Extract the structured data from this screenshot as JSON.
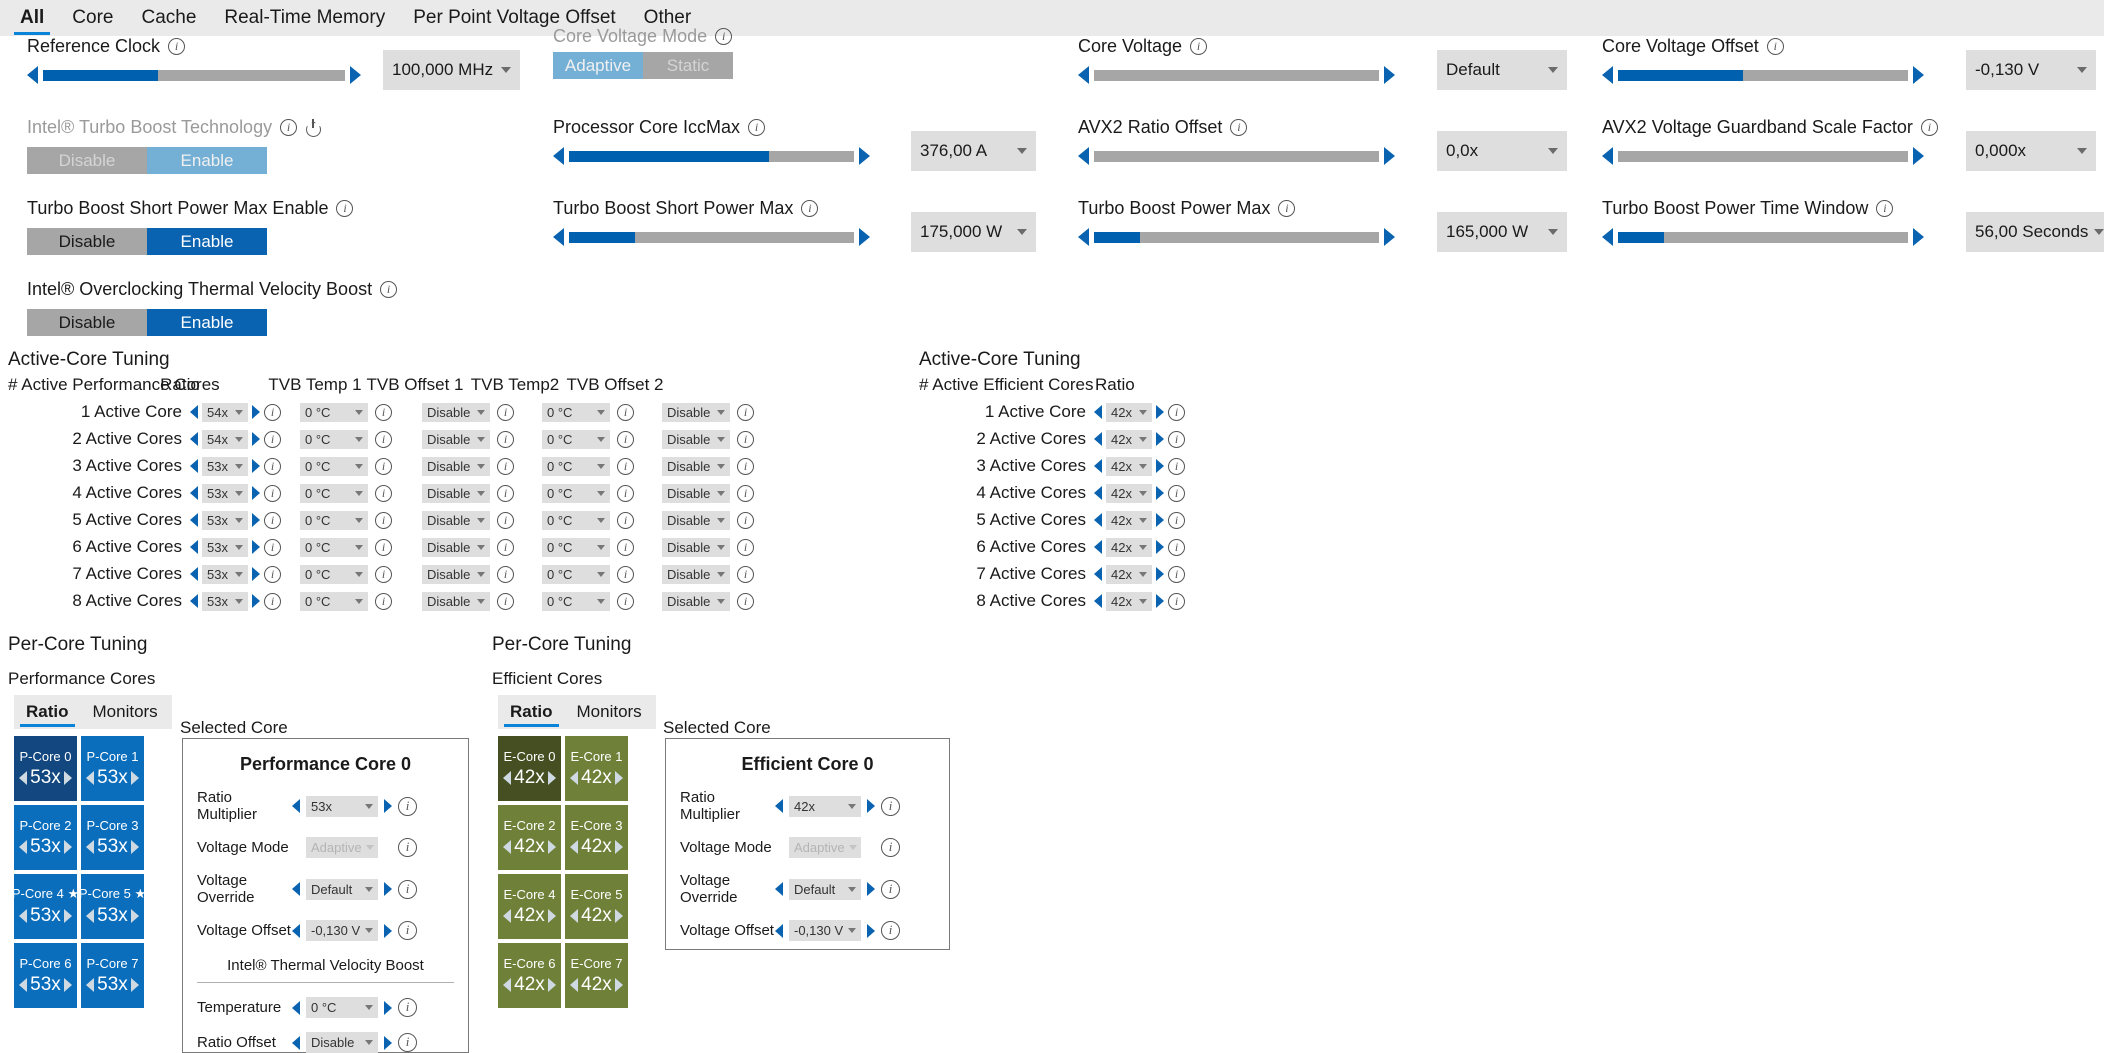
{
  "tabs": [
    {
      "label": "All",
      "active": true
    },
    {
      "label": "Core",
      "active": false
    },
    {
      "label": "Cache",
      "active": false
    },
    {
      "label": "Real-Time Memory",
      "active": false
    },
    {
      "label": "Per Point Voltage Offset",
      "active": false
    },
    {
      "label": "Other",
      "active": false
    }
  ],
  "colors": {
    "accent": "#0a84d8",
    "slider_fill": "#0060b0",
    "toggle_on": "#0a63b0",
    "pcore": "#0a6ebd",
    "pcore_selected": "#12477f",
    "ecore": "#6f8039",
    "ecore_selected": "#454f22"
  },
  "column1": {
    "reference_clock": {
      "label": "Reference Clock",
      "info_icon": "info-icon",
      "value": "100,000 MHz",
      "fill_percent": 38
    },
    "turbo_boost_technology": {
      "label": "Intel® Turbo Boost Technology",
      "info_icon": "info-icon",
      "power_icon": "power-icon",
      "disabled": true,
      "off_label": "Disable",
      "on_label": "Enable",
      "state": "Enable"
    },
    "turbo_boost_short_power_max_enable": {
      "label": "Turbo Boost Short Power Max Enable",
      "info_icon": "info-icon",
      "off_label": "Disable",
      "on_label": "Enable",
      "state": "Enable"
    },
    "oc_thermal_velocity_boost": {
      "label": "Intel® Overclocking Thermal Velocity Boost",
      "info_icon": "info-icon",
      "off_label": "Disable",
      "on_label": "Enable",
      "state": "Enable"
    }
  },
  "column2": {
    "core_voltage_mode": {
      "label": "Core Voltage Mode",
      "info_icon": "info-icon",
      "left_label": "Adaptive",
      "right_label": "Static",
      "state": "Adaptive"
    },
    "processor_core_iccmax": {
      "label": "Processor Core IccMax",
      "info_icon": "info-icon",
      "value": "376,00 A",
      "fill_percent": 70
    },
    "turbo_boost_short_power_max": {
      "label": "Turbo Boost Short Power Max",
      "info_icon": "info-icon",
      "value": "175,000 W",
      "fill_percent": 23
    }
  },
  "column3": {
    "core_voltage": {
      "label": "Core Voltage",
      "info_icon": "info-icon",
      "value": "Default",
      "fill_percent": 0
    },
    "avx2_ratio_offset": {
      "label": "AVX2 Ratio Offset",
      "info_icon": "info-icon",
      "value": "0,0x",
      "fill_percent": 0
    },
    "turbo_boost_power_max": {
      "label": "Turbo Boost Power Max",
      "info_icon": "info-icon",
      "value": "165,000 W",
      "fill_percent": 16
    }
  },
  "column4": {
    "core_voltage_offset": {
      "label": "Core Voltage Offset",
      "info_icon": "info-icon",
      "value": "-0,130 V",
      "fill_percent": 43
    },
    "avx2_voltage_guardband_scale_factor": {
      "label": "AVX2 Voltage Guardband Scale Factor",
      "info_icon": "info-icon",
      "value": "0,000x",
      "fill_percent": 0
    },
    "turbo_boost_power_time_window": {
      "label": "Turbo Boost Power Time Window",
      "info_icon": "info-icon",
      "value": "56,00 Seconds",
      "fill_percent": 16
    }
  },
  "performance_active_core_tuning": {
    "section_title": "Active-Core Tuning",
    "columns": [
      "# Active Performance Cores",
      "Ratio",
      "TVB Temp 1",
      "TVB Offset 1",
      "TVB Temp2",
      "TVB Offset 2"
    ],
    "rows": [
      {
        "name": "1 Active Core",
        "ratio": "54x",
        "tvb_temp1": "0 °C",
        "tvb_offset1": "Disable",
        "tvb_temp2": "0 °C",
        "tvb_offset2": "Disable"
      },
      {
        "name": "2 Active Cores",
        "ratio": "54x",
        "tvb_temp1": "0 °C",
        "tvb_offset1": "Disable",
        "tvb_temp2": "0 °C",
        "tvb_offset2": "Disable"
      },
      {
        "name": "3 Active Cores",
        "ratio": "53x",
        "tvb_temp1": "0 °C",
        "tvb_offset1": "Disable",
        "tvb_temp2": "0 °C",
        "tvb_offset2": "Disable"
      },
      {
        "name": "4 Active Cores",
        "ratio": "53x",
        "tvb_temp1": "0 °C",
        "tvb_offset1": "Disable",
        "tvb_temp2": "0 °C",
        "tvb_offset2": "Disable"
      },
      {
        "name": "5 Active Cores",
        "ratio": "53x",
        "tvb_temp1": "0 °C",
        "tvb_offset1": "Disable",
        "tvb_temp2": "0 °C",
        "tvb_offset2": "Disable"
      },
      {
        "name": "6 Active Cores",
        "ratio": "53x",
        "tvb_temp1": "0 °C",
        "tvb_offset1": "Disable",
        "tvb_temp2": "0 °C",
        "tvb_offset2": "Disable"
      },
      {
        "name": "7 Active Cores",
        "ratio": "53x",
        "tvb_temp1": "0 °C",
        "tvb_offset1": "Disable",
        "tvb_temp2": "0 °C",
        "tvb_offset2": "Disable"
      },
      {
        "name": "8 Active Cores",
        "ratio": "53x",
        "tvb_temp1": "0 °C",
        "tvb_offset1": "Disable",
        "tvb_temp2": "0 °C",
        "tvb_offset2": "Disable"
      }
    ]
  },
  "efficient_active_core_tuning": {
    "section_title": "Active-Core Tuning",
    "columns": [
      "# Active Efficient Cores",
      "Ratio"
    ],
    "rows": [
      {
        "name": "1 Active Core",
        "ratio": "42x"
      },
      {
        "name": "2 Active Cores",
        "ratio": "42x"
      },
      {
        "name": "3 Active Cores",
        "ratio": "42x"
      },
      {
        "name": "4 Active Cores",
        "ratio": "42x"
      },
      {
        "name": "5 Active Cores",
        "ratio": "42x"
      },
      {
        "name": "6 Active Cores",
        "ratio": "42x"
      },
      {
        "name": "7 Active Cores",
        "ratio": "42x"
      },
      {
        "name": "8 Active Cores",
        "ratio": "42x"
      }
    ]
  },
  "performance_per_core": {
    "section_title": "Per-Core Tuning",
    "group_label": "Performance Cores",
    "tabs": [
      {
        "label": "Ratio",
        "active": true
      },
      {
        "label": "Monitors",
        "active": false
      }
    ],
    "selected_core_label": "Selected Core",
    "tiles": [
      {
        "name": "P-Core 0",
        "ratio": "53x",
        "star": false,
        "selected": true
      },
      {
        "name": "P-Core 1",
        "ratio": "53x",
        "star": false,
        "selected": false
      },
      {
        "name": "P-Core 2",
        "ratio": "53x",
        "star": false,
        "selected": false
      },
      {
        "name": "P-Core 3",
        "ratio": "53x",
        "star": false,
        "selected": false
      },
      {
        "name": "P-Core 4",
        "ratio": "53x",
        "star": true,
        "selected": false
      },
      {
        "name": "P-Core 5",
        "ratio": "53x",
        "star": true,
        "selected": false
      },
      {
        "name": "P-Core 6",
        "ratio": "53x",
        "star": false,
        "selected": false
      },
      {
        "name": "P-Core 7",
        "ratio": "53x",
        "star": false,
        "selected": false
      }
    ],
    "panel": {
      "title": "Performance Core 0",
      "rows": [
        {
          "label": "Ratio Multiplier",
          "value": "53x",
          "disabled": false
        },
        {
          "label": "Voltage Mode",
          "value": "Adaptive",
          "disabled": true
        },
        {
          "label": "Voltage Override",
          "value": "Default",
          "disabled": false
        },
        {
          "label": "Voltage Offset",
          "value": "-0,130 V",
          "disabled": false
        }
      ],
      "subheading": "Intel® Thermal Velocity Boost",
      "tvb_rows": [
        {
          "label": "Temperature",
          "value": "0 °C",
          "disabled": false
        },
        {
          "label": "Ratio Offset",
          "value": "Disable",
          "disabled": false
        }
      ]
    }
  },
  "efficient_per_core": {
    "section_title": "Per-Core Tuning",
    "group_label": "Efficient Cores",
    "tabs": [
      {
        "label": "Ratio",
        "active": true
      },
      {
        "label": "Monitors",
        "active": false
      }
    ],
    "selected_core_label": "Selected Core",
    "tiles": [
      {
        "name": "E-Core 0",
        "ratio": "42x",
        "selected": true
      },
      {
        "name": "E-Core 1",
        "ratio": "42x",
        "selected": false
      },
      {
        "name": "E-Core 2",
        "ratio": "42x",
        "selected": false
      },
      {
        "name": "E-Core 3",
        "ratio": "42x",
        "selected": false
      },
      {
        "name": "E-Core 4",
        "ratio": "42x",
        "selected": false
      },
      {
        "name": "E-Core 5",
        "ratio": "42x",
        "selected": false
      },
      {
        "name": "E-Core 6",
        "ratio": "42x",
        "selected": false
      },
      {
        "name": "E-Core 7",
        "ratio": "42x",
        "selected": false
      }
    ],
    "panel": {
      "title": "Efficient Core 0",
      "rows": [
        {
          "label": "Ratio Multiplier",
          "value": "42x",
          "disabled": false
        },
        {
          "label": "Voltage Mode",
          "value": "Adaptive",
          "disabled": true
        },
        {
          "label": "Voltage Override",
          "value": "Default",
          "disabled": false
        },
        {
          "label": "Voltage Offset",
          "value": "-0,130 V",
          "disabled": false
        }
      ]
    }
  }
}
